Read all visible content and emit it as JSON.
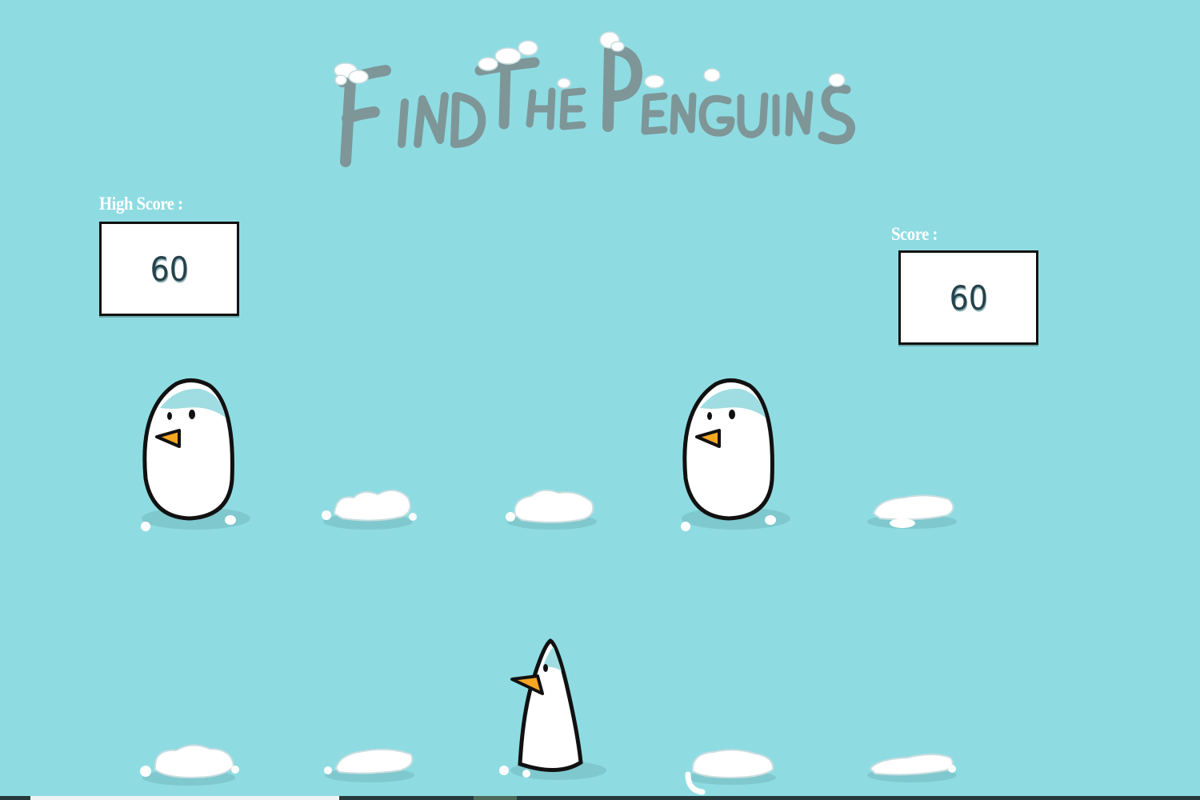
{
  "title": "Find The Penguins",
  "high_score": {
    "label": "High Score :",
    "value": "60"
  },
  "score": {
    "label": "Score :",
    "value": "60"
  },
  "colors": {
    "background": "#8edce2",
    "title": "#7e9698",
    "penguin_beak": "#f5a623",
    "score_text": "#26424a"
  },
  "board": {
    "rows": [
      [
        "penguin",
        "empty",
        "empty",
        "penguin",
        "empty"
      ],
      [
        "empty",
        "empty",
        "penguin-side",
        "empty",
        "empty"
      ]
    ]
  }
}
